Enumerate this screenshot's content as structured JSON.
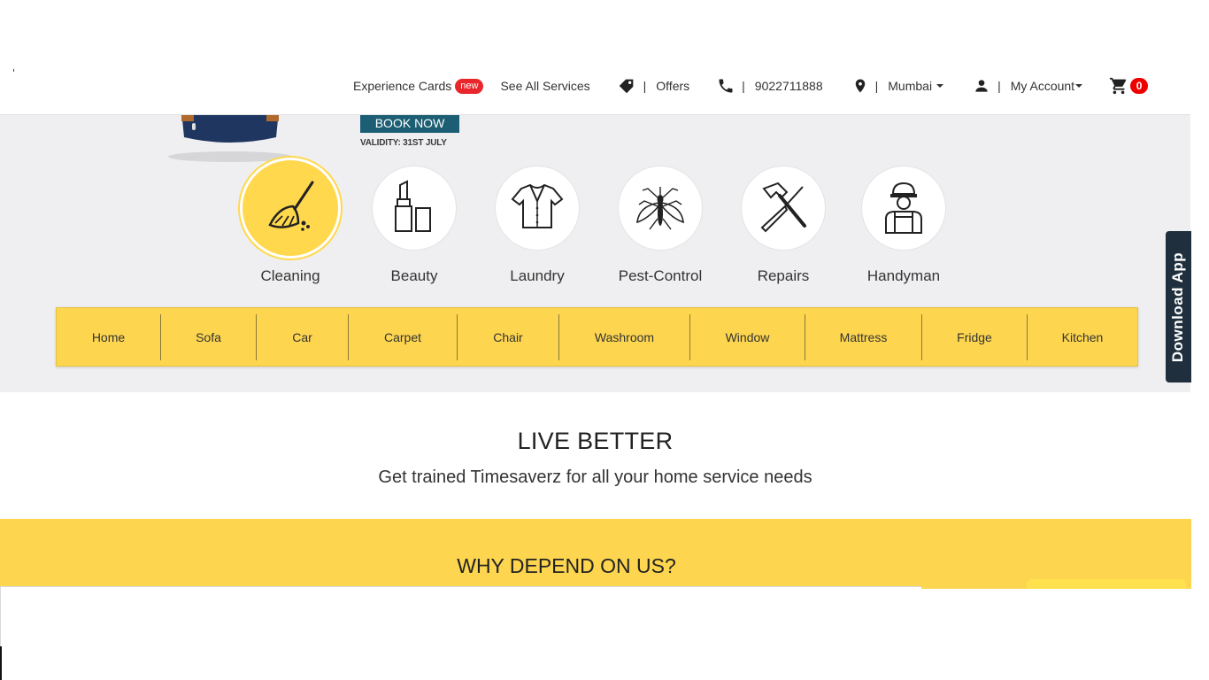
{
  "header": {
    "nav": {
      "experience_cards": "Experience Cards",
      "new_badge": "new",
      "see_all_services": "See All Services",
      "offers": "Offers",
      "phone": "9022711888",
      "city": "Mumbai",
      "account": "My Account",
      "cart_count": "0",
      "separator": "|"
    }
  },
  "hero": {
    "book_now": "BOOK NOW",
    "validity": "VALIDITY: 31ST JULY"
  },
  "services": [
    {
      "label": "Cleaning",
      "icon": "broom-icon",
      "active": true
    },
    {
      "label": "Beauty",
      "icon": "lipstick-icon"
    },
    {
      "label": "Laundry",
      "icon": "shirt-icon"
    },
    {
      "label": "Pest-Control",
      "icon": "mosquito-icon"
    },
    {
      "label": "Repairs",
      "icon": "hammer-screwdriver-icon"
    },
    {
      "label": "Handyman",
      "icon": "worker-icon"
    }
  ],
  "subnav": [
    "Home",
    "Sofa",
    "Car",
    "Carpet",
    "Chair",
    "Washroom",
    "Window",
    "Mattress",
    "Fridge",
    "Kitchen"
  ],
  "download_app": "Download App",
  "live_better": {
    "title": "LIVE BETTER",
    "subtitle": "Get trained Timesaverz for all your home service needs"
  },
  "why": {
    "title": "WHY DEPEND ON US?"
  },
  "colors": {
    "accent_yellow": "#fdd54f",
    "dark_tab": "#1f2f3d",
    "book_button": "#1c5e73",
    "badge_red": "#e8262b"
  }
}
